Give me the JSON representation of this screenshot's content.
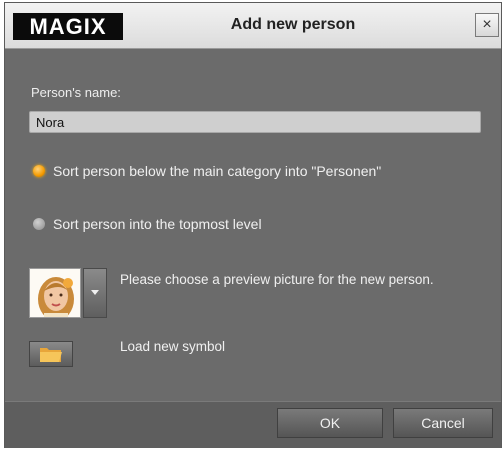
{
  "window": {
    "logo": "MAGIX",
    "title": "Add new person",
    "close_symbol": "×"
  },
  "form": {
    "name_label": "Person's name:",
    "name_value": "Nora",
    "options": [
      {
        "label": "Sort person below the main category into \"Personen\"",
        "selected": true
      },
      {
        "label": "Sort person into the topmost level",
        "selected": false
      }
    ],
    "preview_text": "Please choose a preview picture for the new person.",
    "load_symbol_text": "Load new symbol"
  },
  "icons": {
    "preview": "face-thumbnail-icon",
    "dropdown": "chevron-down-icon",
    "folder": "folder-icon",
    "close": "close-icon"
  },
  "buttons": {
    "ok": "OK",
    "cancel": "Cancel"
  },
  "colors": {
    "accent_radio": "#f59b00",
    "dialog_bg": "#6b6b6b"
  }
}
